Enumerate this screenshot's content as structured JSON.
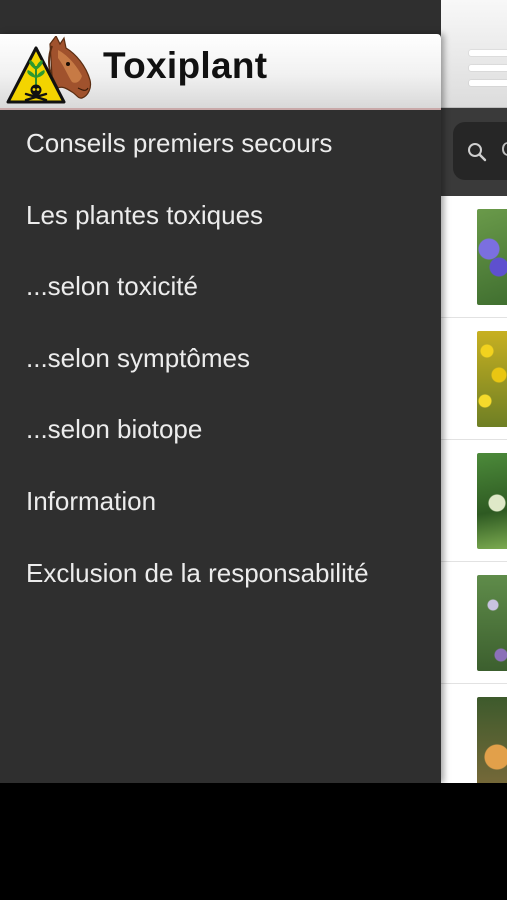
{
  "drawer": {
    "title": "Toxiplant",
    "menu_items": [
      {
        "label": "Conseils premiers secours"
      },
      {
        "label": "Les plantes toxiques"
      },
      {
        "label": "...selon toxicité"
      },
      {
        "label": "...selon symptômes"
      },
      {
        "label": "...selon biotope"
      },
      {
        "label": "Information"
      },
      {
        "label": "Exclusion de la responsabilité"
      }
    ]
  },
  "main": {
    "search": {
      "placeholder_visible": "C"
    },
    "plant_rows": [
      {
        "thumbnail": "blue-flower-photo"
      },
      {
        "thumbnail": "yellow-flower-photo"
      },
      {
        "thumbnail": "green-plant-photo"
      },
      {
        "thumbnail": "purple-flower-photo"
      },
      {
        "thumbnail": "orange-trumpet-flower-photo"
      }
    ]
  },
  "colors": {
    "drawer_bg": "#2f2f2f",
    "menu_text": "#ececec",
    "warning_yellow": "#f3d400",
    "header_gradient_top": "#ffffff",
    "header_gradient_bottom": "#d9d9d9"
  },
  "icons": {
    "logo": "horse-toxic-warning-logo",
    "menu": "hamburger-menu-icon",
    "search": "search-icon"
  }
}
